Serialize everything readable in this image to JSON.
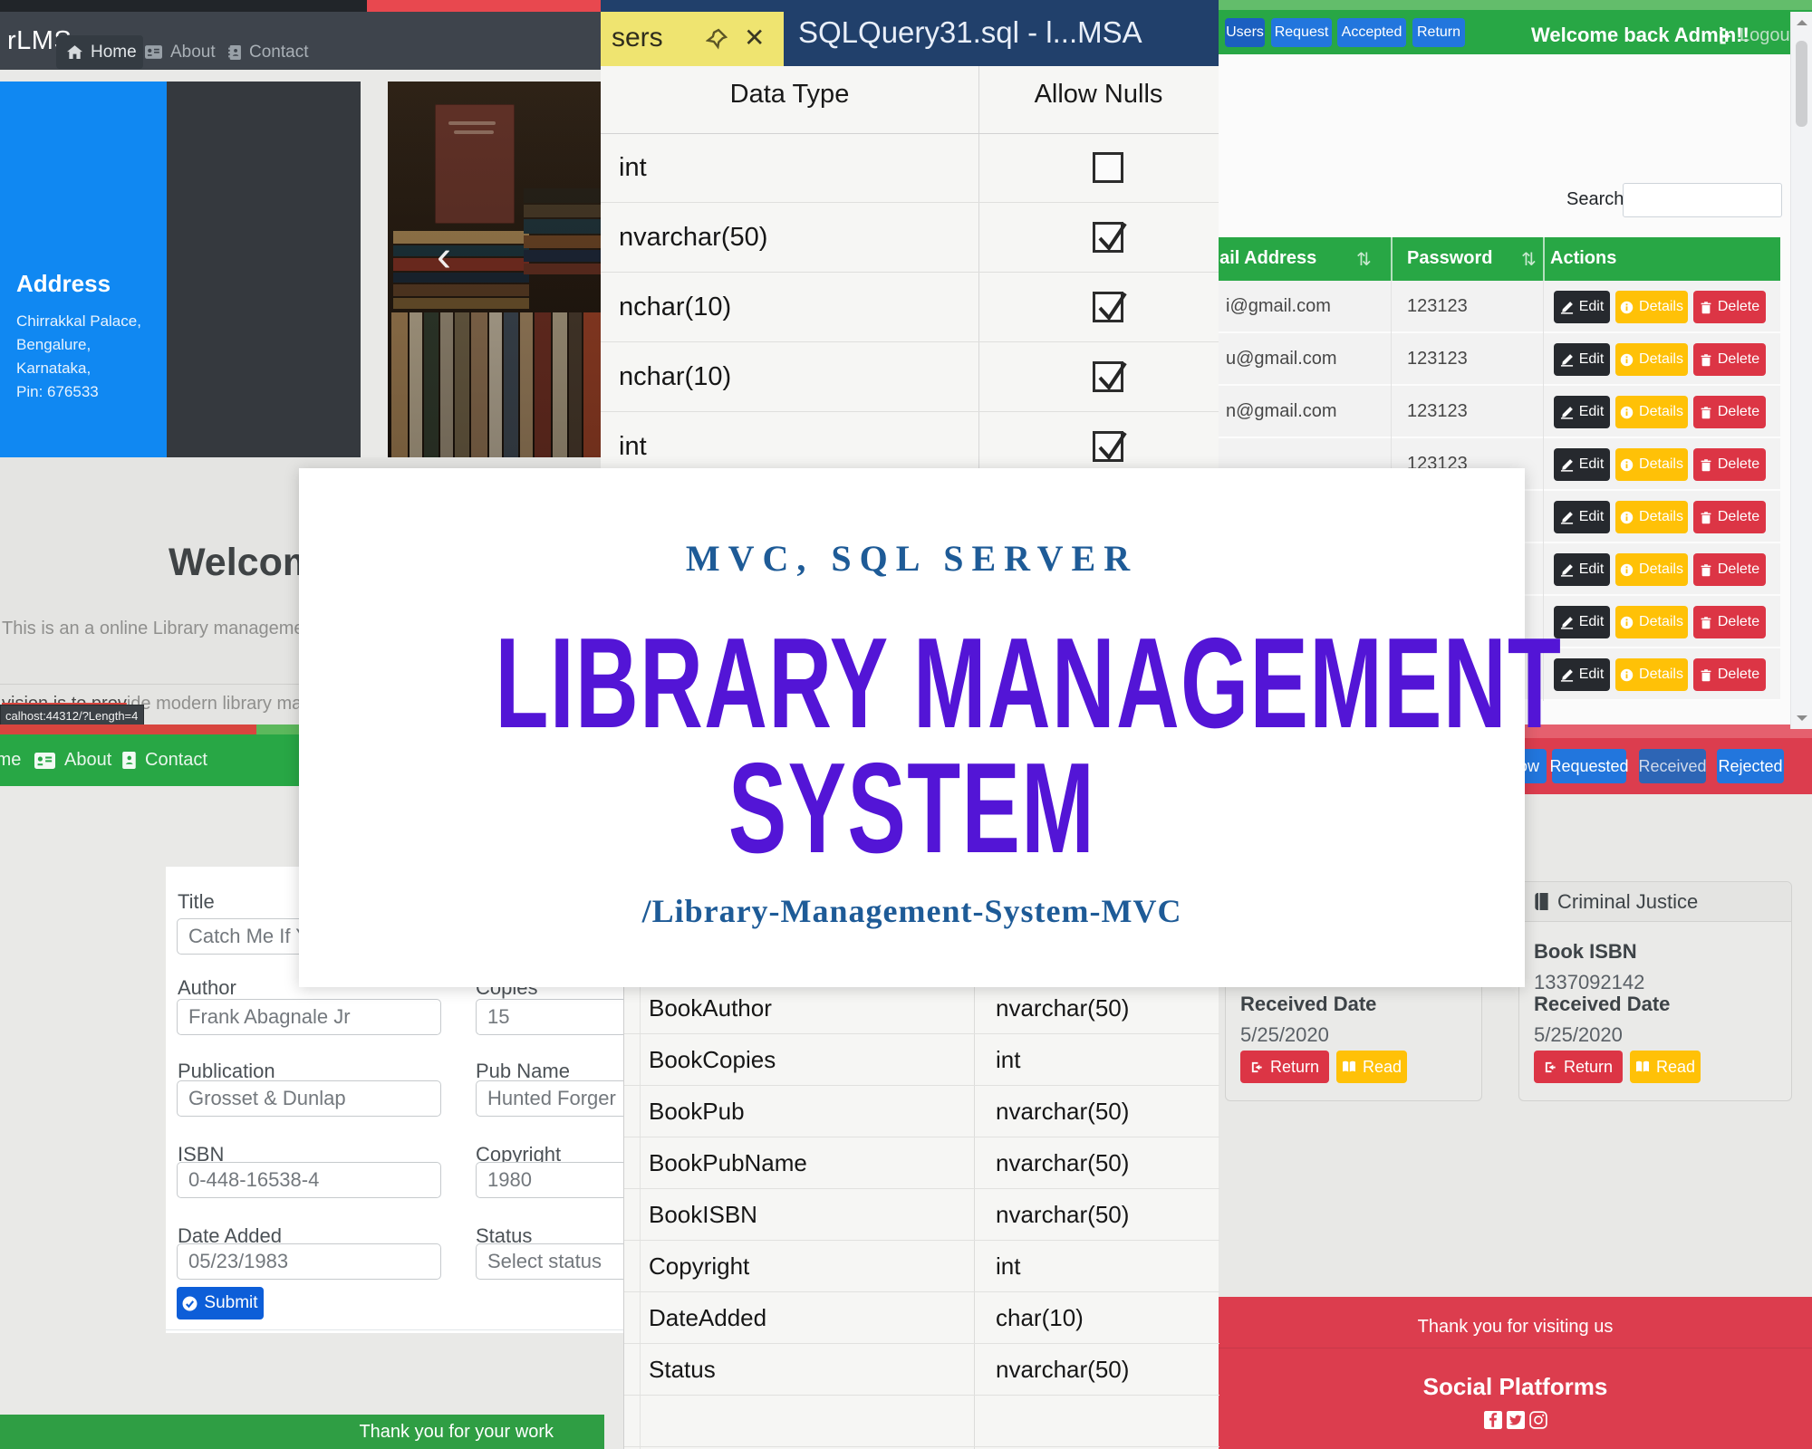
{
  "site": {
    "brand": "rLMS",
    "nav": [
      "Home",
      "About",
      "Contact"
    ],
    "address_card": {
      "title": "Address",
      "lines": [
        "Chirrakkal Palace,",
        "Bengalure,",
        "Karnataka,",
        "Pin: 676533"
      ]
    },
    "carousel": {
      "prev_glyph": "‹"
    },
    "welcome": {
      "heading": "Welcome",
      "para1": "This is an a online Library management",
      "para2_struck": "vision is to prov",
      "para2_rest": "ide modern library manag",
      "tooltip": "calhost:44312/?Length=4"
    },
    "mid_nav": [
      "Home",
      "About",
      "Contact"
    ],
    "footer_green": "Thank you for your work"
  },
  "form": {
    "title_label": "Title",
    "title_value": "Catch Me If You",
    "author_label": "Author",
    "author_value": "Frank Abagnale Jr",
    "copies_label": "Copies",
    "copies_value": "15",
    "publication_label": "Publication",
    "publication_value": "Grosset & Dunlap",
    "pubname_label": "Pub Name",
    "pubname_value": "Hunted Forger",
    "isbn_label": "ISBN",
    "isbn_value": "0-448-16538-4",
    "copyright_label": "Copyright",
    "copyright_value": "1980",
    "date_label": "Date Added",
    "date_value": "05/23/1983",
    "status_label": "Status",
    "status_placeholder": "Select status",
    "submit_label": "Submit"
  },
  "sql_top": {
    "tab_label": "sers",
    "close_glyph": "✕",
    "window_title": "SQLQuery31.sql - l...MSA",
    "col_data_type": "Data Type",
    "col_allow_nulls": "Allow Nulls",
    "rows": [
      {
        "type": "int",
        "allow_null": false
      },
      {
        "type": "nvarchar(50)",
        "allow_null": true
      },
      {
        "type": "nchar(10)",
        "allow_null": true
      },
      {
        "type": "nchar(10)",
        "allow_null": true
      },
      {
        "type": "int",
        "allow_null": true
      }
    ]
  },
  "sql_bottom": {
    "rows": [
      {
        "name": "BookAuthor",
        "type": "nvarchar(50)"
      },
      {
        "name": "BookCopies",
        "type": "int"
      },
      {
        "name": "BookPub",
        "type": "nvarchar(50)"
      },
      {
        "name": "BookPubName",
        "type": "nvarchar(50)"
      },
      {
        "name": "BookISBN",
        "type": "nvarchar(50)"
      },
      {
        "name": "Copyright",
        "type": "int"
      },
      {
        "name": "DateAdded",
        "type": "char(10)"
      },
      {
        "name": "Status",
        "type": "nvarchar(50)"
      },
      {
        "name": "",
        "type": ""
      }
    ]
  },
  "admin": {
    "nav": [
      "Users",
      "Request",
      "Accepted",
      "Return"
    ],
    "welcome": "Welcome back Admin!!",
    "logout_label": "Logout",
    "search_label": "Search:",
    "sort_icon": "⇅",
    "columns": {
      "email": "Email Address",
      "password": "Password",
      "actions": "Actions"
    },
    "action_labels": {
      "edit": "Edit",
      "details": "Details",
      "delete": "Delete"
    },
    "rows": [
      {
        "email": "i@gmail.com",
        "password": "123123"
      },
      {
        "email": "u@gmail.com",
        "password": "123123"
      },
      {
        "email": "n@gmail.com",
        "password": "123123"
      },
      {
        "email": "",
        "password": "123123"
      },
      {
        "email": "",
        "password": ""
      },
      {
        "email": "",
        "password": ""
      },
      {
        "email": "",
        "password": ""
      },
      {
        "email": "",
        "password": ""
      }
    ],
    "request_buttons": [
      "Borrow",
      "Requested",
      "Received",
      "Rejected"
    ]
  },
  "hero": {
    "kicker": "MVC, SQL SERVER",
    "title_line1": "LIBRARY MANAGEMENT",
    "title_line2": "SYSTEM",
    "repo": "/Library-Management-System-MVC"
  },
  "cards": {
    "left": {
      "received_label": "Received Date",
      "received_date": "5/25/2020",
      "return_label": "Return",
      "read_label": "Read"
    },
    "right": {
      "title": "Criminal Justice",
      "isbn_label": "Book ISBN",
      "isbn": "1337092142",
      "received_label": "Received Date",
      "received_date": "5/25/2020",
      "return_label": "Return",
      "read_label": "Read"
    }
  },
  "footer_red": {
    "line1": "Thank you for visiting us",
    "heading": "Social Platforms"
  },
  "colors": {
    "accent_green": "#28a745",
    "accent_red": "#dc3d4e",
    "button_blue": "#2276dd",
    "hero_purple": "#5315d6",
    "hero_navy": "#1e5b97",
    "address_blue": "#1088f2",
    "warning_yellow": "#ffc107",
    "danger_red": "#dc3545",
    "dark_navbar": "#3e444c"
  }
}
